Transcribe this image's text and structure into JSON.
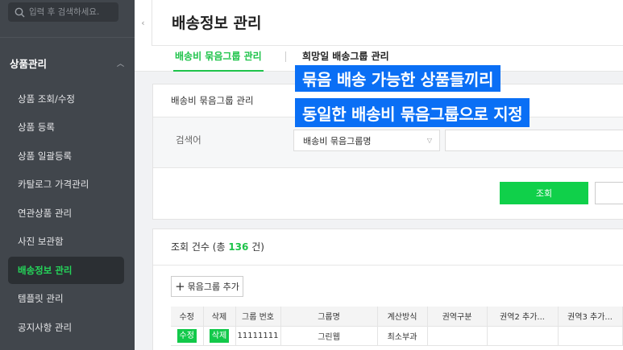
{
  "sidebar": {
    "search_placeholder": "입력 후 검색하세요.",
    "section_label": "상품관리",
    "items": [
      {
        "label": "상품 조회/수정"
      },
      {
        "label": "상품 등록"
      },
      {
        "label": "상품 일괄등록"
      },
      {
        "label": "카탈로그 가격관리"
      },
      {
        "label": "연관상품 관리"
      },
      {
        "label": "사진 보관함"
      },
      {
        "label": "배송정보 관리",
        "active": true
      },
      {
        "label": "템플릿 관리"
      },
      {
        "label": "공지사항 관리"
      }
    ]
  },
  "header": {
    "title": "배송정보 관리",
    "collapse_glyph": "‹"
  },
  "tabs": [
    {
      "label": "배송비 묶음그룹 관리",
      "active": true
    },
    {
      "label": "희망일 배송그룹 관리",
      "active": false
    }
  ],
  "search_card": {
    "title": "배송비 묶음그룹 관리",
    "label": "검색어",
    "select_value": "배송비 묶음그룹명",
    "search_button": "조회"
  },
  "results": {
    "count_prefix": "조회 건수 (총 ",
    "count": "136",
    "count_suffix": " 건)",
    "add_button": "묶음그룹 추가",
    "columns": [
      "수정",
      "삭제",
      "그룹 번호",
      "그룹명",
      "계산방식",
      "권역구분",
      "권역2 추가...",
      "권역3 추가..."
    ],
    "rows": [
      {
        "edit": "수정",
        "delete": "삭제",
        "group_no": "11111111",
        "group_name": "그린웹",
        "calc": "최소부과",
        "region": "",
        "region2": "",
        "region3": ""
      }
    ]
  },
  "callouts": [
    "묶음 배송 가능한 상품들끼리",
    "동일한 배송비 묶음그룹으로 지정"
  ],
  "colors": {
    "accent": "#1ec34a",
    "sidebar_bg": "#41464c",
    "callout_bg": "#0a6ff5"
  }
}
